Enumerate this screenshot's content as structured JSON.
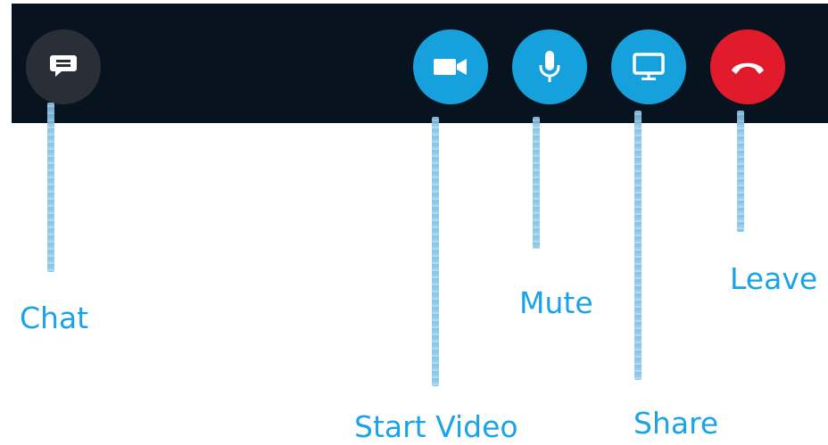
{
  "toolbar": {
    "buttons": {
      "chat": {
        "icon": "chat-bubble-icon",
        "color": "#2a2f37"
      },
      "video": {
        "icon": "video-camera-icon",
        "color": "#16a1dd"
      },
      "mute": {
        "icon": "microphone-icon",
        "color": "#16a1dd"
      },
      "share": {
        "icon": "monitor-share-icon",
        "color": "#16a1dd"
      },
      "leave": {
        "icon": "hang-up-phone-icon",
        "color": "#e21b2c"
      }
    },
    "background": "#07131e"
  },
  "labels": {
    "chat": "Chat",
    "start_video": "Start Video",
    "mute": "Mute",
    "share": "Share",
    "leave": "Leave"
  },
  "label_color": "#1aa3e8"
}
